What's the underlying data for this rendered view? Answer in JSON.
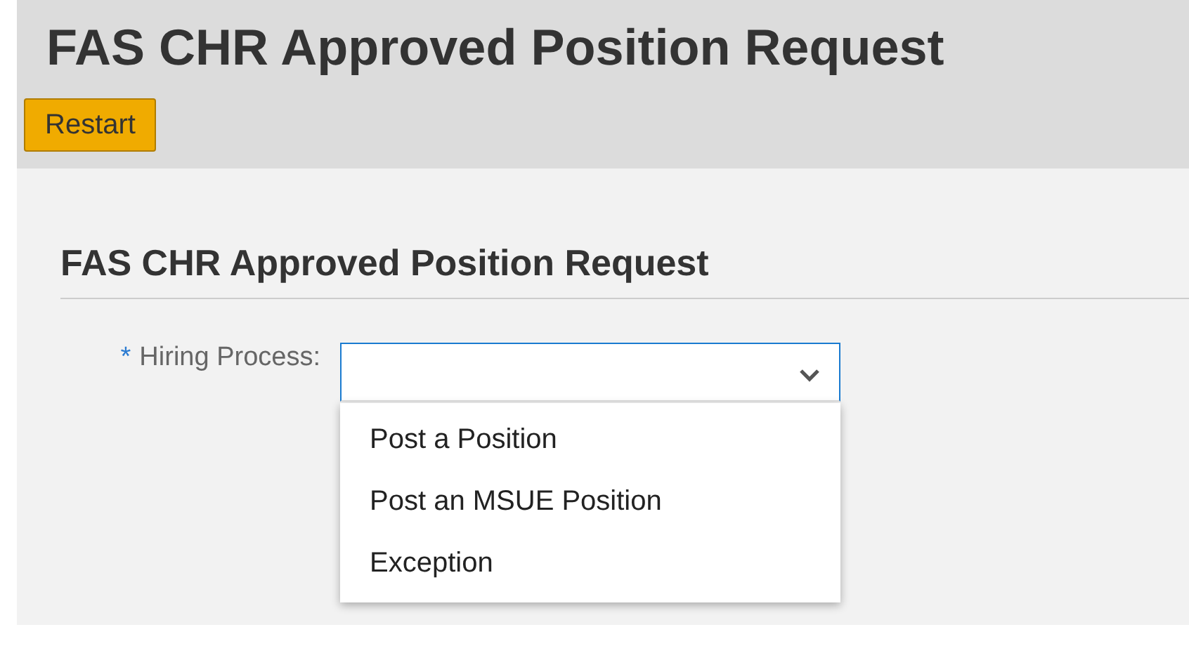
{
  "header": {
    "title": "FAS CHR Approved Position Request",
    "button": "Restart"
  },
  "section": {
    "title": "FAS CHR Approved Position Request"
  },
  "field": {
    "required_mark": "*",
    "label": "Hiring Process:",
    "expanded": true,
    "options": [
      {
        "label": "Post a Position"
      },
      {
        "label": "Post an MSUE Position"
      },
      {
        "label": "Exception"
      }
    ]
  }
}
